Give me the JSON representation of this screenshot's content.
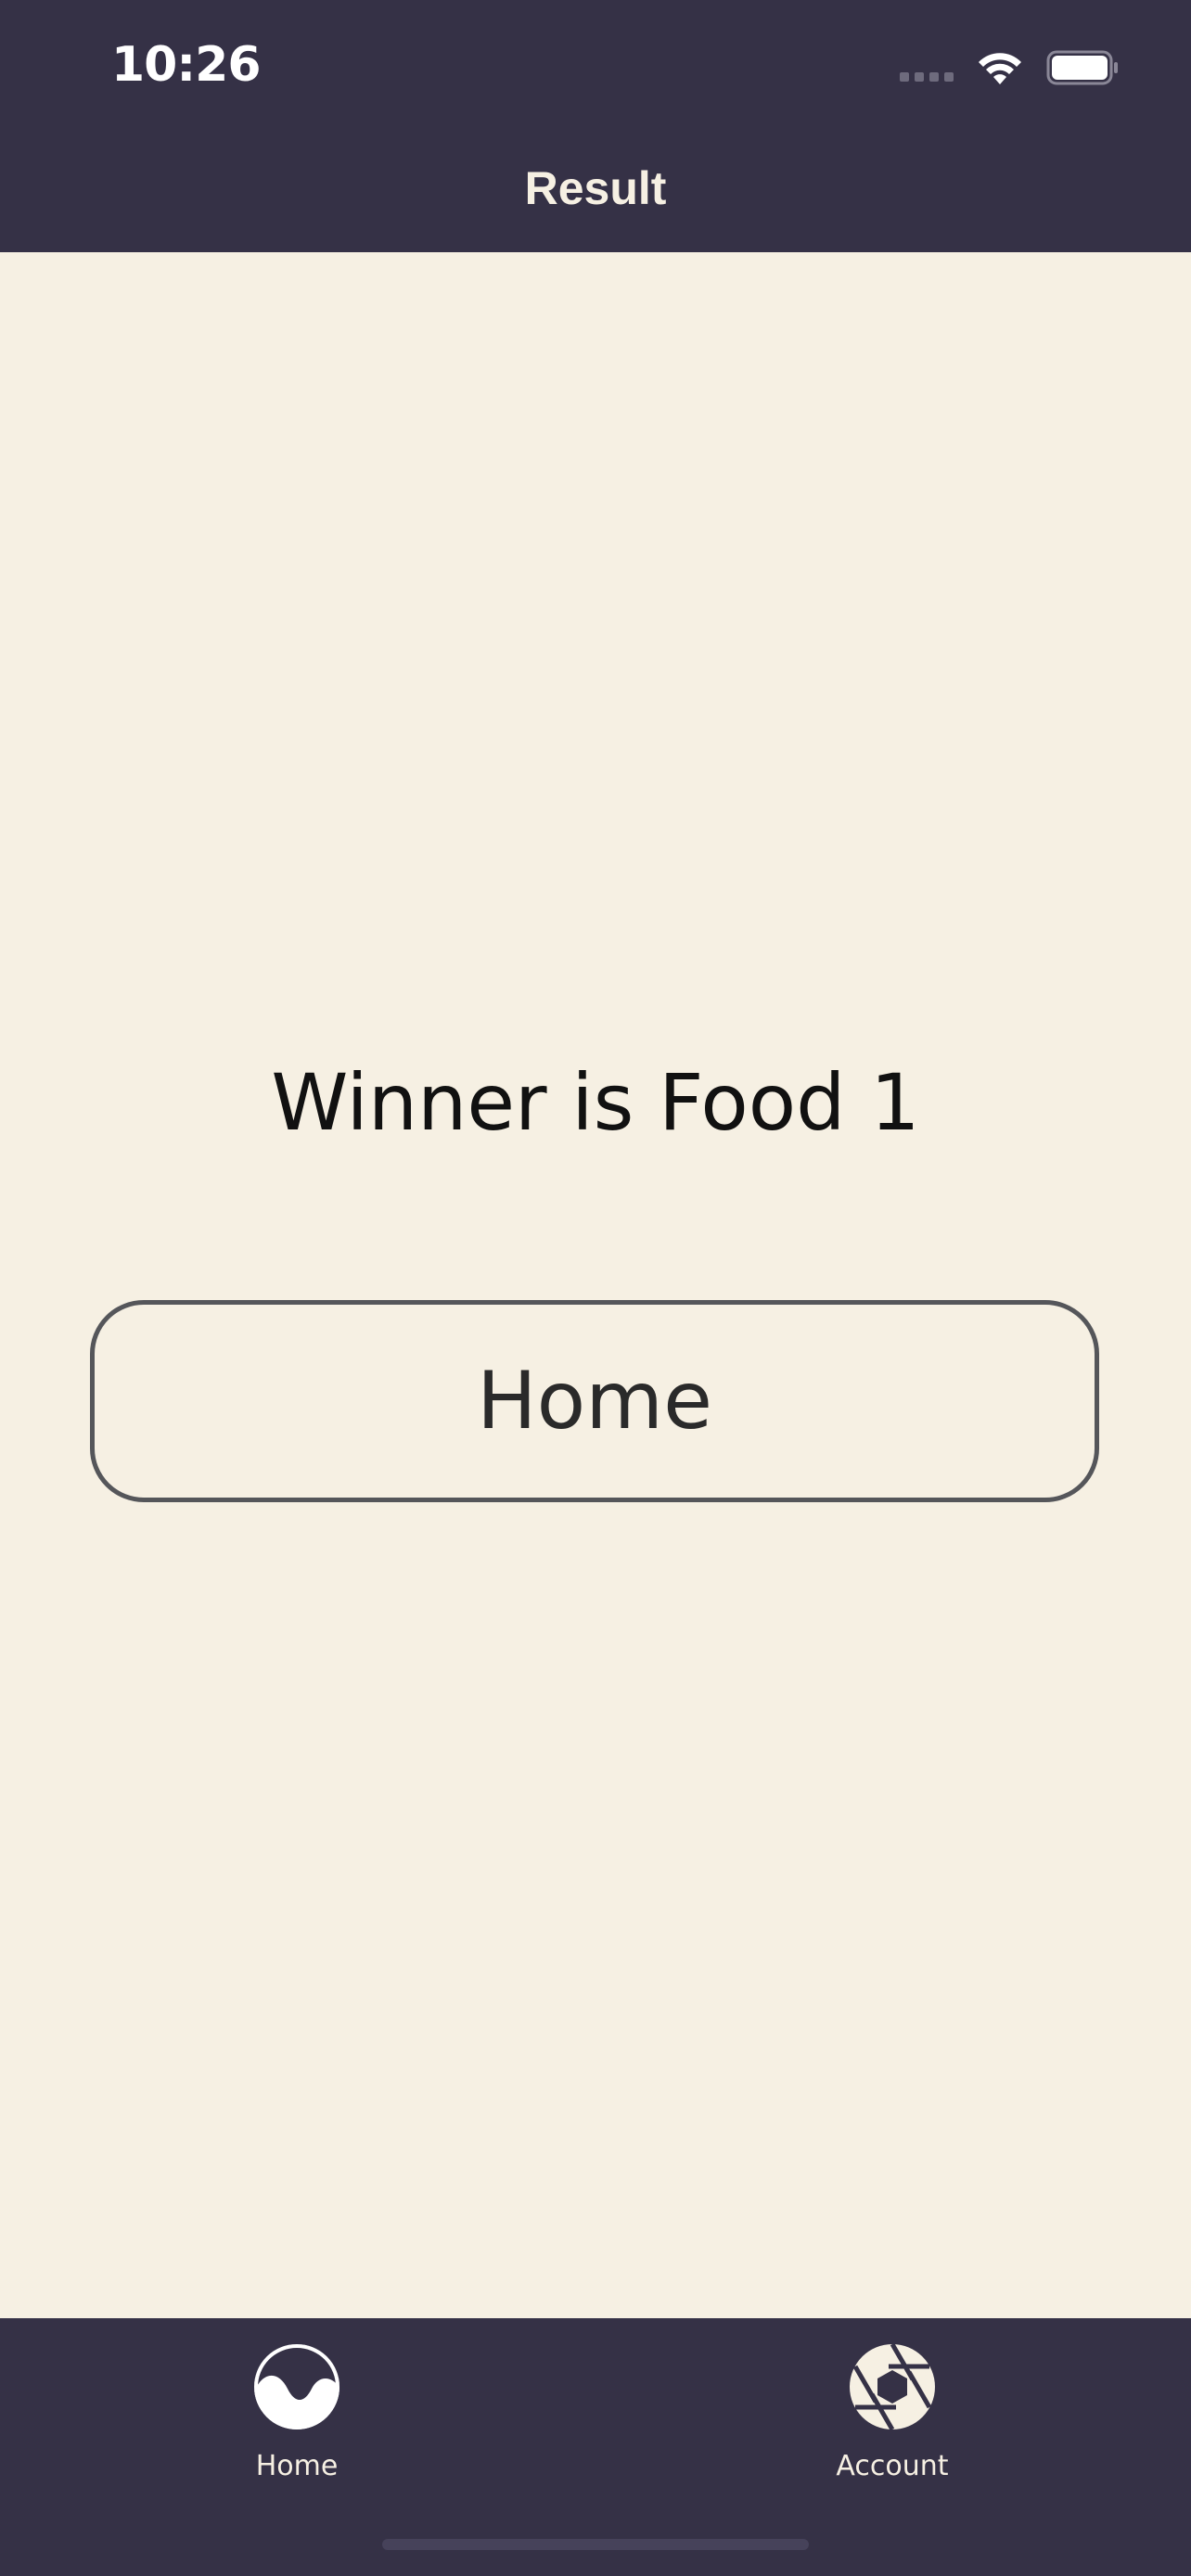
{
  "status_bar": {
    "time": "10:26"
  },
  "header": {
    "title": "Result"
  },
  "main": {
    "winner_text": "Winner is Food 1",
    "home_button_label": "Home"
  },
  "tabbar": {
    "items": [
      {
        "label": "Home",
        "icon": "wave-circle-icon"
      },
      {
        "label": "Account",
        "icon": "aperture-icon"
      }
    ]
  },
  "colors": {
    "header_bg": "#353146",
    "page_bg": "#F6F0E3",
    "button_border": "#55565A"
  }
}
